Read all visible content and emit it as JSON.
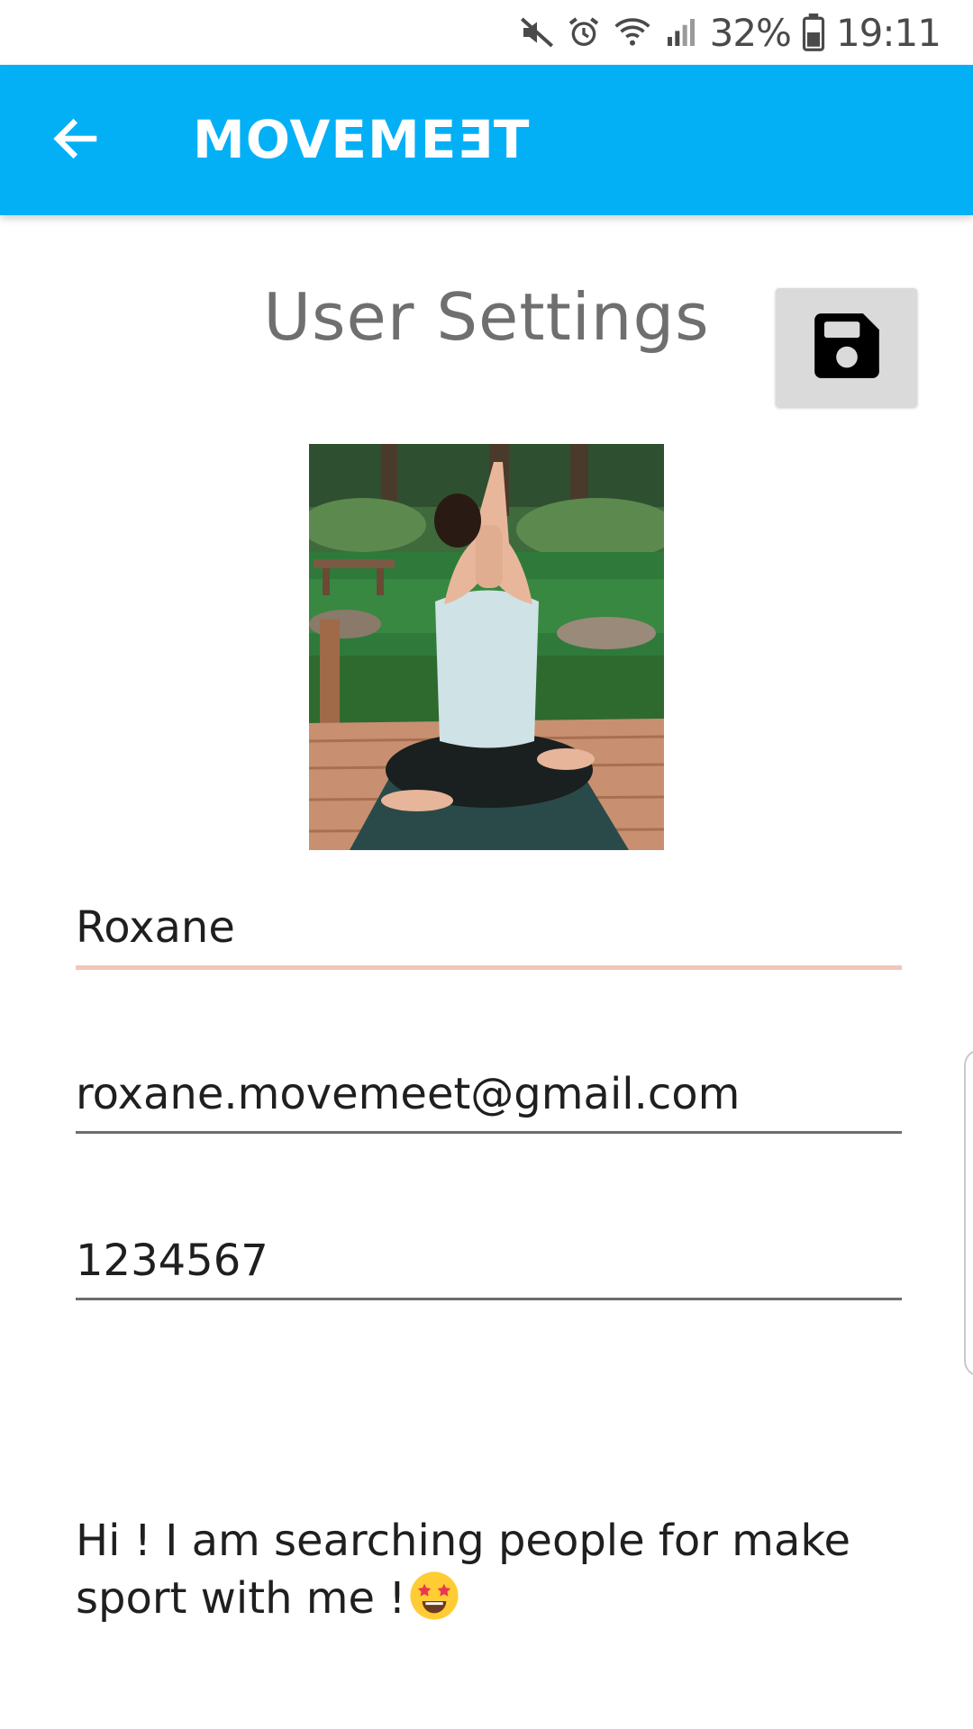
{
  "status_bar": {
    "battery_percent": "32%",
    "time": "19:11",
    "icons": [
      "mute-icon",
      "alarm-icon",
      "wifi-icon",
      "signal-icon",
      "battery-icon"
    ]
  },
  "app_bar": {
    "title": "MOVEMEƎT",
    "back_icon": "arrow-left-icon",
    "background_color": "#03b0f6"
  },
  "page": {
    "title": "User Settings",
    "save_icon": "floppy-disk-icon"
  },
  "profile": {
    "photo_icon": "profile-photo",
    "name": "Roxane",
    "email": "roxane.movemeet@gmail.com",
    "phone": "1234567",
    "bio_text": "Hi ! I am searching people for make sport with me !",
    "bio_emoji": "star-struck-emoji"
  },
  "colors": {
    "active_underline": "#f3c6b8",
    "inactive_underline": "#6d6d6d",
    "save_button_bg": "#dadada"
  }
}
